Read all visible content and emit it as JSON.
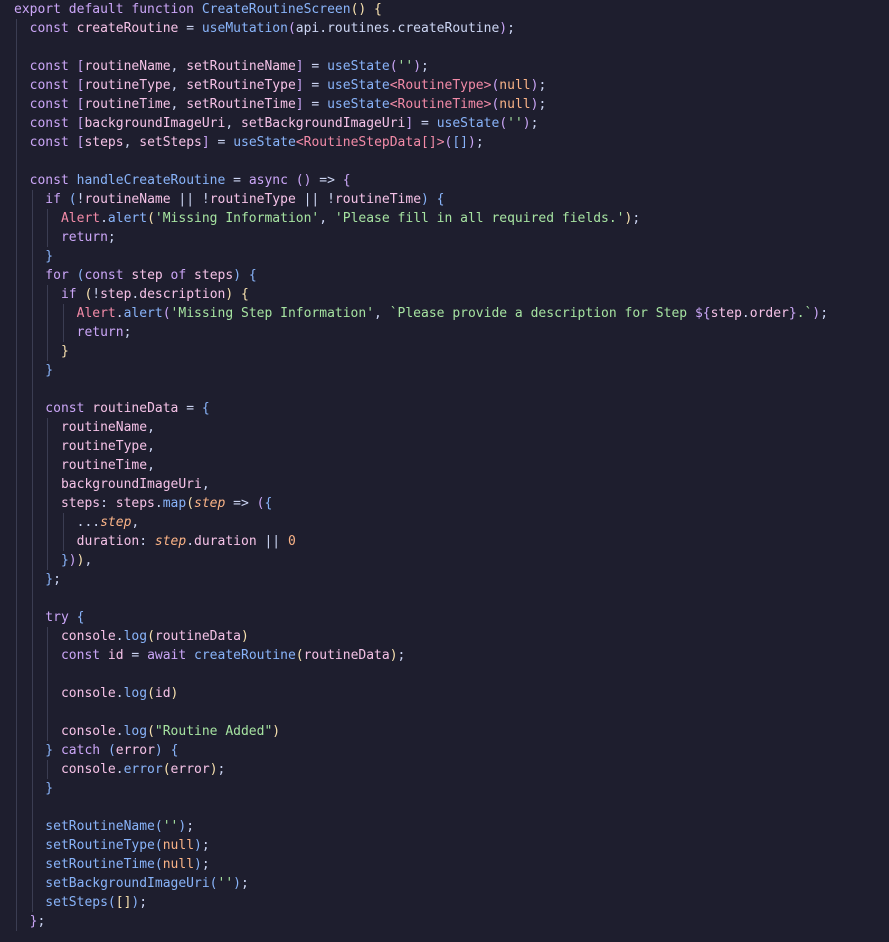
{
  "editor": {
    "language": "TypeScript (React)",
    "colors": {
      "background": "#1e1e2e",
      "keyword": "#cba6f7",
      "function": "#89b4fa",
      "variable": "#f5c2e7",
      "string": "#a6e3a1",
      "type": "#f38ba8",
      "number": "#fab387",
      "text": "#cdd6f4",
      "bracket": "#f9e2af"
    },
    "lines": [
      [
        [
          "k",
          "export default function "
        ],
        [
          "f",
          "CreateRoutineScreen"
        ],
        [
          "b1",
          "()"
        ],
        [
          "p",
          " "
        ],
        [
          "b1",
          "{"
        ]
      ],
      [
        [
          "k",
          "  const "
        ],
        [
          "v",
          "createRoutine"
        ],
        [
          "p",
          " = "
        ],
        [
          "f",
          "useMutation"
        ],
        [
          "b2",
          "("
        ],
        [
          "p",
          "api.routines.createRoutine"
        ],
        [
          "b2",
          ")"
        ],
        [
          "p",
          ";"
        ]
      ],
      [],
      [
        [
          "k",
          "  const "
        ],
        [
          "b2",
          "["
        ],
        [
          "v",
          "routineName"
        ],
        [
          "p",
          ", "
        ],
        [
          "v",
          "setRoutineName"
        ],
        [
          "b2",
          "]"
        ],
        [
          "p",
          " = "
        ],
        [
          "f",
          "useState"
        ],
        [
          "b2",
          "("
        ],
        [
          "s",
          "''"
        ],
        [
          "b2",
          ")"
        ],
        [
          "p",
          ";"
        ]
      ],
      [
        [
          "k",
          "  const "
        ],
        [
          "b2",
          "["
        ],
        [
          "v",
          "routineType"
        ],
        [
          "p",
          ", "
        ],
        [
          "v",
          "setRoutineType"
        ],
        [
          "b2",
          "]"
        ],
        [
          "p",
          " = "
        ],
        [
          "f",
          "useState"
        ],
        [
          "t",
          "<RoutineType>"
        ],
        [
          "b2",
          "("
        ],
        [
          "n",
          "null"
        ],
        [
          "b2",
          ")"
        ],
        [
          "p",
          ";"
        ]
      ],
      [
        [
          "k",
          "  const "
        ],
        [
          "b2",
          "["
        ],
        [
          "v",
          "routineTime"
        ],
        [
          "p",
          ", "
        ],
        [
          "v",
          "setRoutineTime"
        ],
        [
          "b2",
          "]"
        ],
        [
          "p",
          " = "
        ],
        [
          "f",
          "useState"
        ],
        [
          "t",
          "<RoutineTime>"
        ],
        [
          "b2",
          "("
        ],
        [
          "n",
          "null"
        ],
        [
          "b2",
          ")"
        ],
        [
          "p",
          ";"
        ]
      ],
      [
        [
          "k",
          "  const "
        ],
        [
          "b2",
          "["
        ],
        [
          "v",
          "backgroundImageUri"
        ],
        [
          "p",
          ", "
        ],
        [
          "v",
          "setBackgroundImageUri"
        ],
        [
          "b2",
          "]"
        ],
        [
          "p",
          " = "
        ],
        [
          "f",
          "useState"
        ],
        [
          "b2",
          "("
        ],
        [
          "s",
          "''"
        ],
        [
          "b2",
          ")"
        ],
        [
          "p",
          ";"
        ]
      ],
      [
        [
          "k",
          "  const "
        ],
        [
          "b2",
          "["
        ],
        [
          "v",
          "steps"
        ],
        [
          "p",
          ", "
        ],
        [
          "v",
          "setSteps"
        ],
        [
          "b2",
          "]"
        ],
        [
          "p",
          " = "
        ],
        [
          "f",
          "useState"
        ],
        [
          "t",
          "<RoutineStepData[]>"
        ],
        [
          "b2",
          "("
        ],
        [
          "b3",
          "[]"
        ],
        [
          "b2",
          ")"
        ],
        [
          "p",
          ";"
        ]
      ],
      [],
      [
        [
          "k",
          "  const "
        ],
        [
          "f",
          "handleCreateRoutine"
        ],
        [
          "p",
          " = "
        ],
        [
          "k",
          "async "
        ],
        [
          "b2",
          "()"
        ],
        [
          "p",
          " => "
        ],
        [
          "b2",
          "{"
        ]
      ],
      [
        [
          "k",
          "    if "
        ],
        [
          "b3",
          "("
        ],
        [
          "p",
          "!"
        ],
        [
          "v",
          "routineName"
        ],
        [
          "p",
          " || !"
        ],
        [
          "v",
          "routineType"
        ],
        [
          "p",
          " || !"
        ],
        [
          "v",
          "routineTime"
        ],
        [
          "b3",
          ")"
        ],
        [
          "p",
          " "
        ],
        [
          "b3",
          "{"
        ]
      ],
      [
        [
          "t",
          "      Alert"
        ],
        [
          "p",
          "."
        ],
        [
          "f",
          "alert"
        ],
        [
          "b1",
          "("
        ],
        [
          "s",
          "'Missing Information'"
        ],
        [
          "p",
          ", "
        ],
        [
          "s",
          "'Please fill in all required fields.'"
        ],
        [
          "b1",
          ")"
        ],
        [
          "p",
          ";"
        ]
      ],
      [
        [
          "k",
          "      return"
        ],
        [
          "p",
          ";"
        ]
      ],
      [
        [
          "b3",
          "    }"
        ]
      ],
      [
        [
          "k",
          "    for "
        ],
        [
          "b3",
          "("
        ],
        [
          "k",
          "const "
        ],
        [
          "v",
          "step"
        ],
        [
          "k",
          " of "
        ],
        [
          "v",
          "steps"
        ],
        [
          "b3",
          ")"
        ],
        [
          "p",
          " "
        ],
        [
          "b3",
          "{"
        ]
      ],
      [
        [
          "k",
          "      if "
        ],
        [
          "b1",
          "("
        ],
        [
          "p",
          "!"
        ],
        [
          "v",
          "step"
        ],
        [
          "p",
          "."
        ],
        [
          "v",
          "description"
        ],
        [
          "b1",
          ")"
        ],
        [
          "p",
          " "
        ],
        [
          "b1",
          "{"
        ]
      ],
      [
        [
          "t",
          "        Alert"
        ],
        [
          "p",
          "."
        ],
        [
          "f",
          "alert"
        ],
        [
          "b2",
          "("
        ],
        [
          "s",
          "'Missing Step Information'"
        ],
        [
          "p",
          ", "
        ],
        [
          "s",
          "`Please provide a description for Step "
        ],
        [
          "k",
          "${"
        ],
        [
          "v",
          "step"
        ],
        [
          "p",
          "."
        ],
        [
          "v",
          "order"
        ],
        [
          "k",
          "}"
        ],
        [
          "s",
          ".`"
        ],
        [
          "b2",
          ")"
        ],
        [
          "p",
          ";"
        ]
      ],
      [
        [
          "k",
          "        return"
        ],
        [
          "p",
          ";"
        ]
      ],
      [
        [
          "b1",
          "      }"
        ]
      ],
      [
        [
          "b3",
          "    }"
        ]
      ],
      [],
      [
        [
          "k",
          "    const "
        ],
        [
          "v",
          "routineData"
        ],
        [
          "p",
          " = "
        ],
        [
          "b3",
          "{"
        ]
      ],
      [
        [
          "v",
          "      routineName"
        ],
        [
          "p",
          ","
        ]
      ],
      [
        [
          "v",
          "      routineType"
        ],
        [
          "p",
          ","
        ]
      ],
      [
        [
          "v",
          "      routineTime"
        ],
        [
          "p",
          ","
        ]
      ],
      [
        [
          "v",
          "      backgroundImageUri"
        ],
        [
          "p",
          ","
        ]
      ],
      [
        [
          "v",
          "      steps"
        ],
        [
          "p",
          ": "
        ],
        [
          "v",
          "steps"
        ],
        [
          "p",
          "."
        ],
        [
          "f",
          "map"
        ],
        [
          "b1",
          "("
        ],
        [
          "it",
          "step"
        ],
        [
          "p",
          " => "
        ],
        [
          "b2",
          "("
        ],
        [
          "b3",
          "{"
        ]
      ],
      [
        [
          "p",
          "        ..."
        ],
        [
          "it",
          "step"
        ],
        [
          "p",
          ","
        ]
      ],
      [
        [
          "v",
          "        duration"
        ],
        [
          "p",
          ": "
        ],
        [
          "it",
          "step"
        ],
        [
          "p",
          "."
        ],
        [
          "v",
          "duration"
        ],
        [
          "p",
          " || "
        ],
        [
          "n",
          "0"
        ]
      ],
      [
        [
          "b3",
          "      }"
        ],
        [
          "b2",
          ")"
        ],
        [
          "b1",
          ")"
        ],
        [
          "p",
          ","
        ]
      ],
      [
        [
          "b3",
          "    }"
        ],
        [
          "p",
          ";"
        ]
      ],
      [],
      [
        [
          "k",
          "    try "
        ],
        [
          "b3",
          "{"
        ]
      ],
      [
        [
          "v",
          "      console"
        ],
        [
          "p",
          "."
        ],
        [
          "f",
          "log"
        ],
        [
          "b1",
          "("
        ],
        [
          "v",
          "routineData"
        ],
        [
          "b1",
          ")"
        ]
      ],
      [
        [
          "k",
          "      const "
        ],
        [
          "v",
          "id"
        ],
        [
          "p",
          " = "
        ],
        [
          "k",
          "await "
        ],
        [
          "f",
          "createRoutine"
        ],
        [
          "b1",
          "("
        ],
        [
          "v",
          "routineData"
        ],
        [
          "b1",
          ")"
        ],
        [
          "p",
          ";"
        ]
      ],
      [],
      [
        [
          "v",
          "      console"
        ],
        [
          "p",
          "."
        ],
        [
          "f",
          "log"
        ],
        [
          "b1",
          "("
        ],
        [
          "v",
          "id"
        ],
        [
          "b1",
          ")"
        ]
      ],
      [],
      [
        [
          "v",
          "      console"
        ],
        [
          "p",
          "."
        ],
        [
          "f",
          "log"
        ],
        [
          "b1",
          "("
        ],
        [
          "s",
          "\"Routine Added\""
        ],
        [
          "b1",
          ")"
        ]
      ],
      [
        [
          "b3",
          "    }"
        ],
        [
          "k",
          " catch "
        ],
        [
          "b3",
          "("
        ],
        [
          "v",
          "error"
        ],
        [
          "b3",
          ")"
        ],
        [
          "p",
          " "
        ],
        [
          "b3",
          "{"
        ]
      ],
      [
        [
          "v",
          "      console"
        ],
        [
          "p",
          "."
        ],
        [
          "f",
          "error"
        ],
        [
          "b1",
          "("
        ],
        [
          "v",
          "error"
        ],
        [
          "b1",
          ")"
        ],
        [
          "p",
          ";"
        ]
      ],
      [
        [
          "b3",
          "    }"
        ]
      ],
      [],
      [
        [
          "f",
          "    setRoutineName"
        ],
        [
          "b3",
          "("
        ],
        [
          "s",
          "''"
        ],
        [
          "b3",
          ")"
        ],
        [
          "p",
          ";"
        ]
      ],
      [
        [
          "f",
          "    setRoutineType"
        ],
        [
          "b3",
          "("
        ],
        [
          "n",
          "null"
        ],
        [
          "b3",
          ")"
        ],
        [
          "p",
          ";"
        ]
      ],
      [
        [
          "f",
          "    setRoutineTime"
        ],
        [
          "b3",
          "("
        ],
        [
          "n",
          "null"
        ],
        [
          "b3",
          ")"
        ],
        [
          "p",
          ";"
        ]
      ],
      [
        [
          "f",
          "    setBackgroundImageUri"
        ],
        [
          "b3",
          "("
        ],
        [
          "s",
          "''"
        ],
        [
          "b3",
          ")"
        ],
        [
          "p",
          ";"
        ]
      ],
      [
        [
          "f",
          "    setSteps"
        ],
        [
          "b3",
          "("
        ],
        [
          "b1",
          "[]"
        ],
        [
          "b3",
          ")"
        ],
        [
          "p",
          ";"
        ]
      ],
      [
        [
          "b2",
          "  }"
        ],
        [
          "p",
          ";"
        ]
      ]
    ]
  }
}
